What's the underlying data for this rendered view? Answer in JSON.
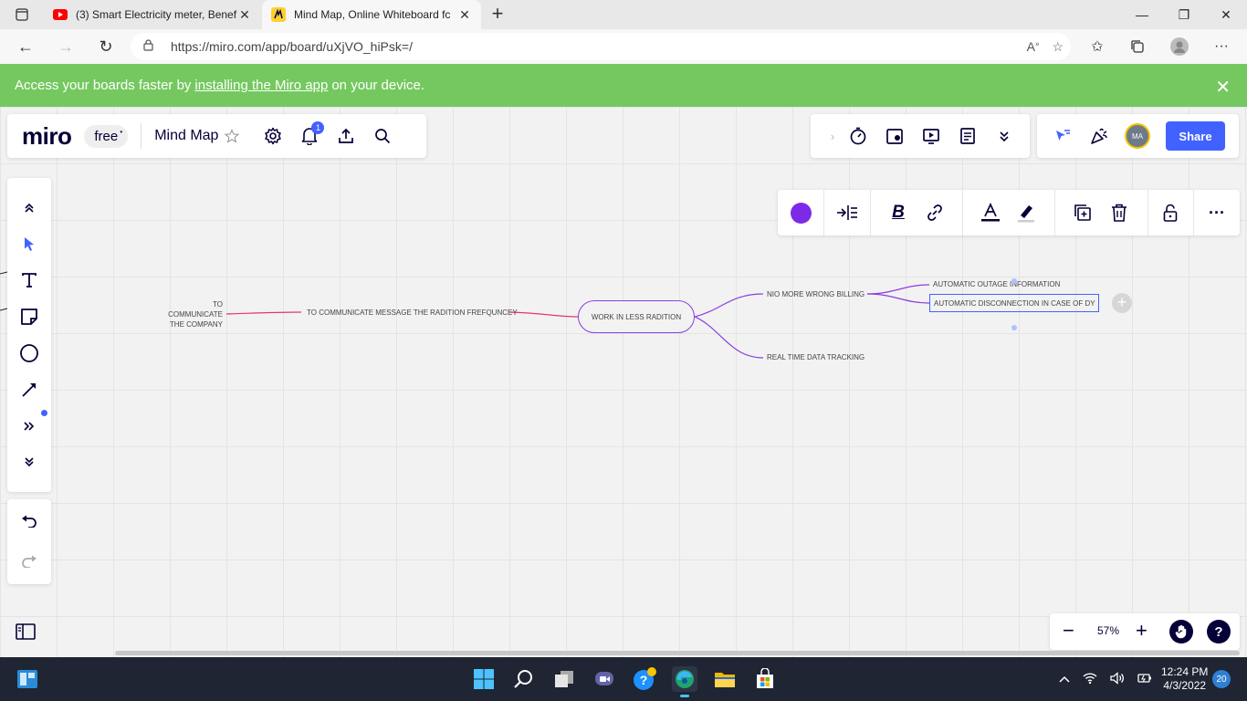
{
  "browser": {
    "tabs": [
      {
        "title": "(3) Smart Electricity meter, Benef",
        "favicon": "youtube-icon",
        "active": false
      },
      {
        "title": "Mind Map, Online Whiteboard fc",
        "favicon": "miro-icon",
        "active": true
      }
    ],
    "url": "https://miro.com/app/board/uXjVO_hiPsk=/"
  },
  "banner": {
    "prefix": "Access your boards faster by",
    "link": "installing the Miro app",
    "suffix": "on your device."
  },
  "board": {
    "logo": "miro",
    "plan": "free",
    "plan_dot": "•",
    "name": "Mind Map",
    "notification_count": "1",
    "share_label": "Share",
    "avatar_initials": "MA",
    "zoom": "57%"
  },
  "mindmap": {
    "center": "WORK IN LESS RADITION",
    "left_branch": "TO COMMUNICATE MESSAGE THE RADITION FREFQUNCEY",
    "left_leaf": "TO COMMUNICATE THE COMPANY",
    "right_branch_1": "NIO MORE WRONG BILLING",
    "right_branch_2": "REAL TIME DATA TRACKING",
    "leaf_1": "AUTOMATIC OUTAGE INFORMATION",
    "leaf_2": "AUTOMATIC  DISCONNECTION IN CASE OF DY",
    "line_color_left": "#e8336d",
    "line_color_right": "#8a3ee0"
  },
  "taskbar": {
    "time": "12:24 PM",
    "date": "4/3/2022",
    "notifications": "20"
  },
  "colors": {
    "banner": "#74c85f",
    "accent": "#4262ff",
    "selected_color": "#7d2ae8"
  }
}
